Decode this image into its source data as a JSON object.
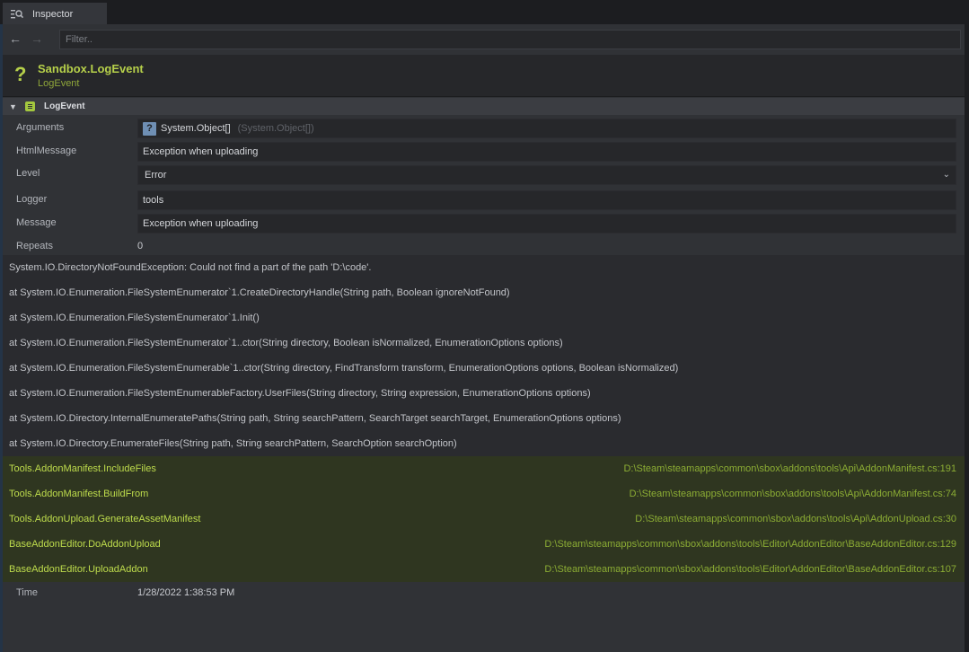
{
  "tab": {
    "label": "Inspector",
    "icon": "inspector-icon"
  },
  "filter": {
    "placeholder": "Filter..",
    "value": ""
  },
  "header": {
    "title": "Sandbox.LogEvent",
    "subtitle": "LogEvent",
    "icon": "question-mark-icon"
  },
  "section": {
    "label": "LogEvent",
    "icon": "document-icon"
  },
  "properties": {
    "arguments": {
      "label": "Arguments",
      "type_badge": "?",
      "value": "System.Object[]",
      "hint": "(System.Object[])"
    },
    "htmlmessage": {
      "label": "HtmlMessage",
      "value": "Exception when uploading"
    },
    "level": {
      "label": "Level",
      "value": "Error"
    },
    "logger": {
      "label": "Logger",
      "value": "tools"
    },
    "message": {
      "label": "Message",
      "value": "Exception when uploading"
    },
    "repeats": {
      "label": "Repeats",
      "value": "0"
    },
    "time": {
      "label": "Time",
      "value": "1/28/2022 1:38:53 PM"
    }
  },
  "stacktrace": [
    "System.IO.DirectoryNotFoundException: Could not find a part of the path 'D:\\code'.",
    "at System.IO.Enumeration.FileSystemEnumerator`1.CreateDirectoryHandle(String path, Boolean ignoreNotFound)",
    "at System.IO.Enumeration.FileSystemEnumerator`1.Init()",
    "at System.IO.Enumeration.FileSystemEnumerator`1..ctor(String directory, Boolean isNormalized, EnumerationOptions options)",
    "at System.IO.Enumeration.FileSystemEnumerable`1..ctor(String directory, FindTransform transform, EnumerationOptions options, Boolean isNormalized)",
    "at System.IO.Enumeration.FileSystemEnumerableFactory.UserFiles(String directory, String expression, EnumerationOptions options)",
    "at System.IO.Directory.InternalEnumeratePaths(String path, String searchPattern, SearchTarget searchTarget, EnumerationOptions options)",
    "at System.IO.Directory.EnumerateFiles(String path, String searchPattern, SearchOption searchOption)"
  ],
  "frames": [
    {
      "fn": "Tools.AddonManifest.IncludeFiles",
      "file": "D:\\Steam\\steamapps\\common\\sbox\\addons\\tools\\Api\\AddonManifest.cs:191"
    },
    {
      "fn": "Tools.AddonManifest.BuildFrom",
      "file": "D:\\Steam\\steamapps\\common\\sbox\\addons\\tools\\Api\\AddonManifest.cs:74"
    },
    {
      "fn": "Tools.AddonUpload.GenerateAssetManifest",
      "file": "D:\\Steam\\steamapps\\common\\sbox\\addons\\tools\\Api\\AddonUpload.cs:30"
    },
    {
      "fn": "BaseAddonEditor.DoAddonUpload",
      "file": "D:\\Steam\\steamapps\\common\\sbox\\addons\\tools\\Editor\\AddonEditor\\BaseAddonEditor.cs:129"
    },
    {
      "fn": "BaseAddonEditor.UploadAddon",
      "file": "D:\\Steam\\steamapps\\common\\sbox\\addons\\tools\\Editor\\AddonEditor\\BaseAddonEditor.cs:107"
    }
  ],
  "colors": {
    "accent": "#b6d04a",
    "frame_bg": "#2f3620",
    "panel_bg": "#303236"
  }
}
